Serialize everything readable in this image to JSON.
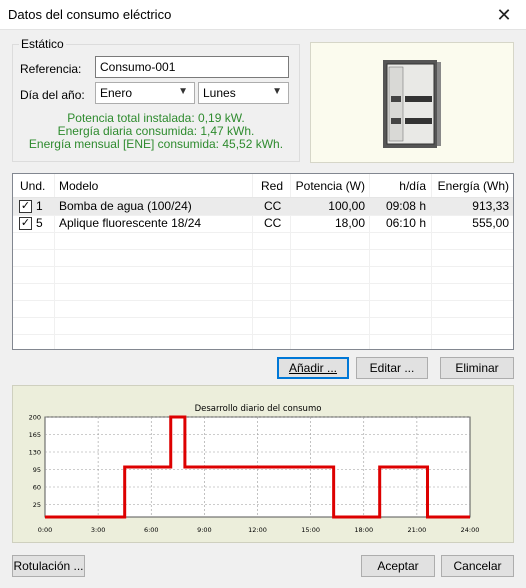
{
  "window": {
    "title": "Datos del consumo eléctrico"
  },
  "group": {
    "legend": "Estático",
    "referencia_label": "Referencia:",
    "referencia_value": "Consumo-001",
    "dia_label": "Día del año:",
    "month_value": "Enero",
    "weekday_value": "Lunes",
    "info": [
      "Potencia total instalada: 0,19 kW.",
      "Energía diaria consumida: 1,47 kWh.",
      "Energía mensual [ENE] consumida: 45,52 kWh."
    ]
  },
  "table": {
    "headers": {
      "und": "Und.",
      "modelo": "Modelo",
      "red": "Red",
      "potencia": "Potencia (W)",
      "hdia": "h/día",
      "energia": "Energía (Wh)"
    },
    "rows": [
      {
        "checked": true,
        "und": "1",
        "modelo": "Bomba de agua (100/24)",
        "red": "CC",
        "potencia": "100,00",
        "hdia": "09:08 h",
        "energia": "913,33"
      },
      {
        "checked": true,
        "und": "5",
        "modelo": "Aplique fluorescente 18/24",
        "red": "CC",
        "potencia": "18,00",
        "hdia": "06:10 h",
        "energia": "555,00"
      }
    ]
  },
  "buttons": {
    "add": "Añadir ...",
    "edit": "Editar ...",
    "delete": "Eliminar",
    "labels": "Rotulación ...",
    "accept": "Aceptar",
    "cancel": "Cancelar"
  },
  "colors": {
    "accent": "#0078d7",
    "info_text": "#2e8b2e",
    "chart_line": "#dd0000",
    "chart_bg": "#eceedb"
  },
  "icons": {
    "close": "close-icon",
    "dropdown": "chevron-down-icon",
    "checkbox": "checkbox-checked-icon",
    "preview": "electrical-panel-image"
  },
  "chart_data": {
    "type": "line",
    "title": "Desarrollo diario del consumo",
    "xlabel": "",
    "ylabel": "",
    "xlim": [
      0,
      24
    ],
    "ylim": [
      0,
      200
    ],
    "x_ticks": [
      "0:00",
      "3:00",
      "6:00",
      "9:00",
      "12:00",
      "15:00",
      "18:00",
      "21:00",
      "24:00"
    ],
    "y_ticks": [
      "25",
      "60",
      "95",
      "130",
      "165",
      "200"
    ],
    "grid": true,
    "series": [
      {
        "x": [
          0,
          4.5,
          4.5,
          7.1,
          7.1,
          7.9,
          7.9,
          16.3,
          16.3,
          18.9,
          18.9,
          21.6,
          21.6,
          24
        ],
        "y": [
          0,
          0,
          100,
          100,
          200,
          200,
          100,
          100,
          0,
          0,
          100,
          100,
          0,
          0
        ]
      }
    ]
  }
}
